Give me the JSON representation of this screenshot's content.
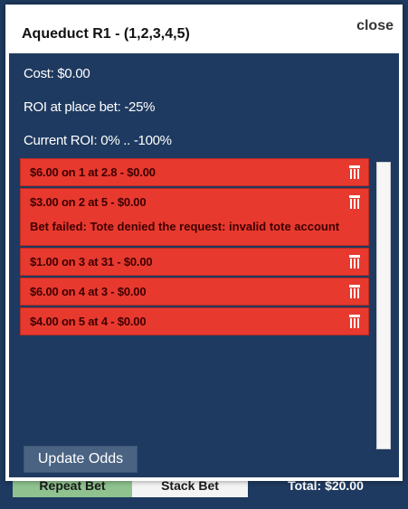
{
  "background_bar": {
    "repeat_label": "Repeat Bet",
    "stack_label": "Stack Bet",
    "total_label": "Total: $20.00"
  },
  "popup": {
    "title": "Aqueduct R1 - (1,2,3,4,5)",
    "close_label": "close"
  },
  "stats": {
    "cost": "Cost: $0.00",
    "roi_place": "ROI at place bet: -25%",
    "roi_current": "Current ROI: 0% .. -100%"
  },
  "bets": [
    {
      "text": "$6.00 on 1 at 2.8 - $0.00",
      "icon": "trash-icon"
    },
    {
      "text": "$3.00 on 2 at 5 - $0.00",
      "icon": "trash-icon",
      "error": "Bet failed: Tote denied the request: invalid tote account"
    },
    {
      "text": "$1.00 on 3 at 31 - $0.00",
      "icon": "trash-icon"
    },
    {
      "text": "$6.00 on 4 at 3 - $0.00",
      "icon": "trash-icon"
    },
    {
      "text": "$4.00 on 5 at 4 - $0.00",
      "icon": "trash-icon"
    }
  ],
  "update_button_label": "Update Odds",
  "colors": {
    "popup_bg": "#1f3a60",
    "bet_bg": "#e8392f",
    "bet_text": "#3d0000",
    "button_bg": "#4a6383"
  }
}
